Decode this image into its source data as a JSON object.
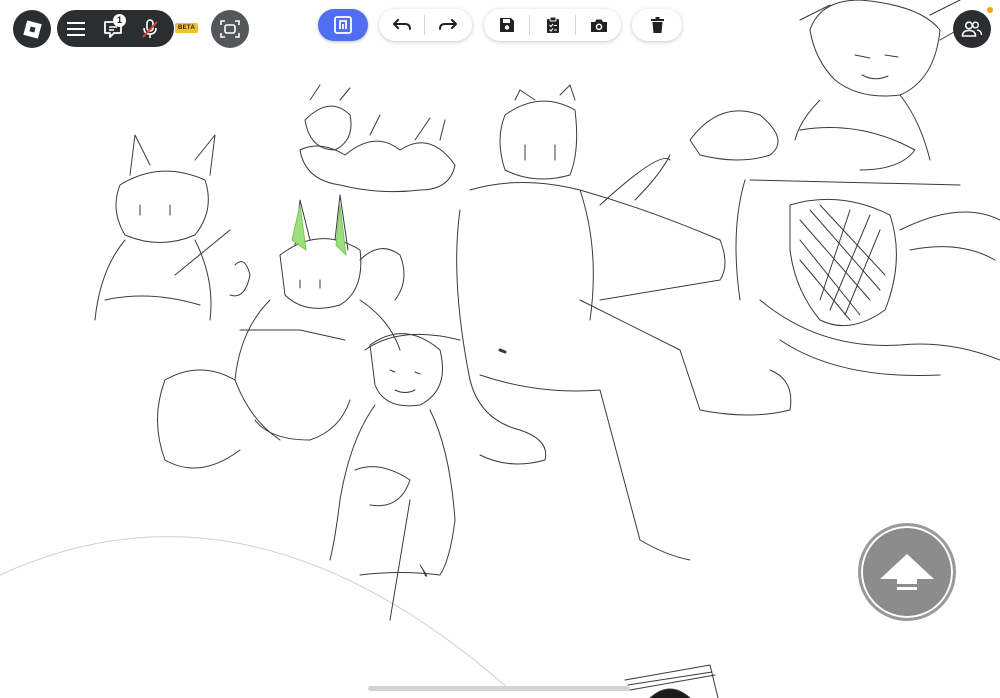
{
  "top_bar": {
    "roblox_menu": {
      "icon": "roblox-logo-icon"
    },
    "menu_pill": {
      "hamburger": {
        "icon": "hamburger-icon"
      },
      "chat": {
        "icon": "chat-icon",
        "badge_count": "1"
      },
      "mic": {
        "icon": "mic-muted-icon"
      }
    },
    "beta_label": "BETA",
    "self_view": {
      "icon": "self-view-icon"
    }
  },
  "drawing_toolbar": {
    "active_tool": {
      "icon": "brush-tool-icon"
    },
    "history": [
      {
        "icon": "undo-icon"
      },
      {
        "icon": "redo-icon"
      }
    ],
    "actions": [
      {
        "icon": "save-icon"
      },
      {
        "icon": "clipboard-icon"
      },
      {
        "icon": "camera-icon"
      }
    ],
    "delete": {
      "icon": "trash-icon"
    }
  },
  "friends": {
    "icon": "people-icon",
    "status_color": "#f0a500"
  },
  "jump_button": {
    "icon": "jump-arrow-icon"
  },
  "canvas": {
    "background": "#ffffff",
    "stroke_color": "#3a3a3a",
    "accent_color": "#9be07a"
  },
  "colors": {
    "dark_button": "#2b2d31",
    "accent": "#4f6ef2",
    "beta": "#f2c12e"
  }
}
